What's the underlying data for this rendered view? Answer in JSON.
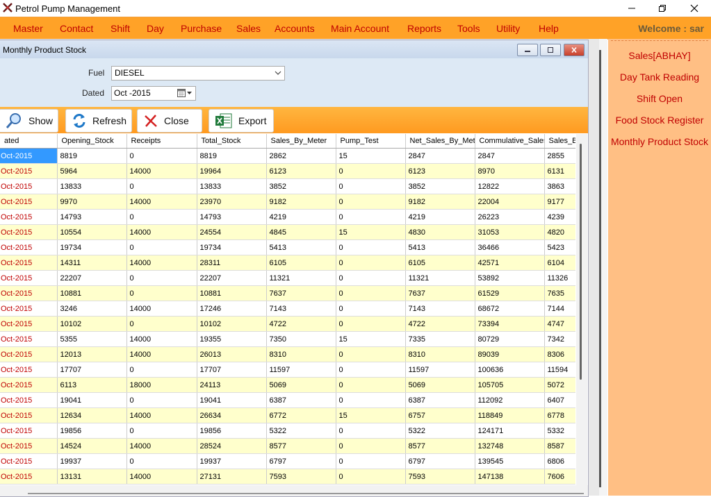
{
  "window": {
    "title": "Petrol Pump Management"
  },
  "menu": {
    "items": [
      "Master",
      "Contact",
      "Shift",
      "Day",
      "Purchase",
      "Sales",
      "Accounts",
      "Main Account",
      "Reports",
      "Tools",
      "Utility",
      "Help"
    ],
    "welcome": "Welcome : sar"
  },
  "child": {
    "title": "Monthly Product Stock",
    "fuel_label": "Fuel",
    "fuel_value": "DIESEL",
    "dated_label": "Dated",
    "dated_value": "Oct -2015"
  },
  "toolbar": {
    "show": "Show",
    "refresh": "Refresh",
    "close": "Close",
    "export": "Export"
  },
  "grid": {
    "columns": [
      "ated",
      "Opening_Stock",
      "Receipts",
      "Total_Stock",
      "Sales_By_Meter",
      "Pump_Test",
      "Net_Sales_By_Met",
      "Commulative_Sales",
      "Sales_B"
    ],
    "rows": [
      [
        "Oct-2015",
        "8819",
        "0",
        "8819",
        "2862",
        "15",
        "2847",
        "2847",
        "2855"
      ],
      [
        "Oct-2015",
        "5964",
        "14000",
        "19964",
        "6123",
        "0",
        "6123",
        "8970",
        "6131"
      ],
      [
        "Oct-2015",
        "13833",
        "0",
        "13833",
        "3852",
        "0",
        "3852",
        "12822",
        "3863"
      ],
      [
        "Oct-2015",
        "9970",
        "14000",
        "23970",
        "9182",
        "0",
        "9182",
        "22004",
        "9177"
      ],
      [
        "Oct-2015",
        "14793",
        "0",
        "14793",
        "4219",
        "0",
        "4219",
        "26223",
        "4239"
      ],
      [
        "Oct-2015",
        "10554",
        "14000",
        "24554",
        "4845",
        "15",
        "4830",
        "31053",
        "4820"
      ],
      [
        "Oct-2015",
        "19734",
        "0",
        "19734",
        "5413",
        "0",
        "5413",
        "36466",
        "5423"
      ],
      [
        "Oct-2015",
        "14311",
        "14000",
        "28311",
        "6105",
        "0",
        "6105",
        "42571",
        "6104"
      ],
      [
        "Oct-2015",
        "22207",
        "0",
        "22207",
        "11321",
        "0",
        "11321",
        "53892",
        "11326"
      ],
      [
        "Oct-2015",
        "10881",
        "0",
        "10881",
        "7637",
        "0",
        "7637",
        "61529",
        "7635"
      ],
      [
        "Oct-2015",
        "3246",
        "14000",
        "17246",
        "7143",
        "0",
        "7143",
        "68672",
        "7144"
      ],
      [
        "Oct-2015",
        "10102",
        "0",
        "10102",
        "4722",
        "0",
        "4722",
        "73394",
        "4747"
      ],
      [
        "Oct-2015",
        "5355",
        "14000",
        "19355",
        "7350",
        "15",
        "7335",
        "80729",
        "7342"
      ],
      [
        "Oct-2015",
        "12013",
        "14000",
        "26013",
        "8310",
        "0",
        "8310",
        "89039",
        "8306"
      ],
      [
        "Oct-2015",
        "17707",
        "0",
        "17707",
        "11597",
        "0",
        "11597",
        "100636",
        "11594"
      ],
      [
        "Oct-2015",
        "6113",
        "18000",
        "24113",
        "5069",
        "0",
        "5069",
        "105705",
        "5072"
      ],
      [
        "Oct-2015",
        "19041",
        "0",
        "19041",
        "6387",
        "0",
        "6387",
        "112092",
        "6407"
      ],
      [
        "Oct-2015",
        "12634",
        "14000",
        "26634",
        "6772",
        "15",
        "6757",
        "118849",
        "6778"
      ],
      [
        "Oct-2015",
        "19856",
        "0",
        "19856",
        "5322",
        "0",
        "5322",
        "124171",
        "5332"
      ],
      [
        "Oct-2015",
        "14524",
        "14000",
        "28524",
        "8577",
        "0",
        "8577",
        "132748",
        "8587"
      ],
      [
        "Oct-2015",
        "19937",
        "0",
        "19937",
        "6797",
        "0",
        "6797",
        "139545",
        "6806"
      ],
      [
        "Oct-2015",
        "13131",
        "14000",
        "27131",
        "7593",
        "0",
        "7593",
        "147138",
        "7606"
      ]
    ]
  },
  "side_panel": {
    "items": [
      "Sales[ABHAY]",
      "Day Tank Reading",
      "Shift Open",
      "Food Stock Register",
      "Monthly Product Stock"
    ]
  },
  "colors": {
    "menu_bg": "#ffa227",
    "menu_text": "#c00000",
    "side_bg": "#ffbf84",
    "alt_row": "#ffffcc",
    "selection": "#3399ff"
  }
}
